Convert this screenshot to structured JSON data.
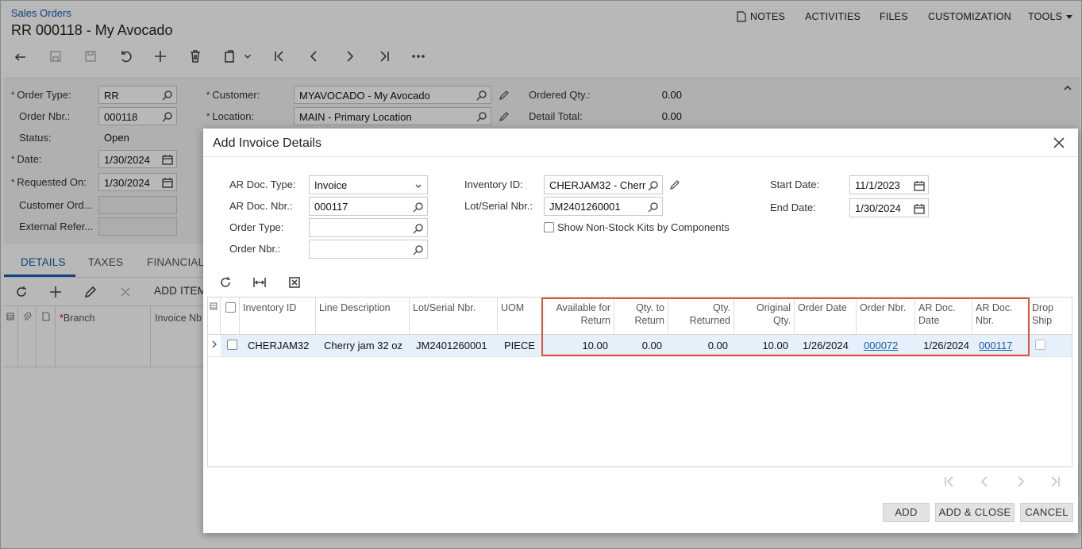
{
  "header": {
    "breadcrumb": "Sales Orders",
    "title": "RR 000118 - My Avocado",
    "nav": [
      "NOTES",
      "ACTIVITIES",
      "FILES",
      "CUSTOMIZATION",
      "TOOLS"
    ]
  },
  "summary": {
    "order_type_label": "Order Type:",
    "order_type": "RR",
    "order_nbr_label": "Order Nbr.:",
    "order_nbr": "000118",
    "status_label": "Status:",
    "status": "Open",
    "date_label": "Date:",
    "date": "1/30/2024",
    "requested_on_label": "Requested On:",
    "requested_on": "1/30/2024",
    "customer_ord_label": "Customer Ord...",
    "external_ref_label": "External Refer...",
    "customer_label": "Customer:",
    "customer": "MYAVOCADO - My Avocado",
    "location_label": "Location:",
    "location": "MAIN - Primary Location",
    "ordered_qty_label": "Ordered Qty.:",
    "ordered_qty": "0.00",
    "detail_total_label": "Detail Total:",
    "detail_total": "0.00"
  },
  "tabs": [
    "DETAILS",
    "TAXES",
    "FINANCIAL"
  ],
  "details_toolbar": {
    "add_item": "ADD ITEM"
  },
  "details_grid": {
    "branch": "Branch",
    "invoice_nbr": "Invoice Nb"
  },
  "dialog": {
    "title": "Add Invoice Details",
    "ar_doc_type_label": "AR Doc. Type:",
    "ar_doc_type": "Invoice",
    "ar_doc_nbr_label": "AR Doc. Nbr.:",
    "ar_doc_nbr": "000117",
    "order_type_label": "Order Type:",
    "order_type": "",
    "order_nbr_label": "Order Nbr.:",
    "order_nbr": "",
    "inventory_id_label": "Inventory ID:",
    "inventory_id": "CHERJAM32 - Cherr",
    "lot_serial_label": "Lot/Serial Nbr.:",
    "lot_serial": "JM2401260001",
    "show_nonstock_label": "Show Non-Stock Kits by Components",
    "start_date_label": "Start Date:",
    "start_date": "11/1/2023",
    "end_date_label": "End Date:",
    "end_date": "1/30/2024",
    "columns": {
      "inventory_id": "Inventory ID",
      "line_desc": "Line Description",
      "lot_serial": "Lot/Serial Nbr.",
      "uom": "UOM",
      "avail": "Available for Return",
      "qty_to_return": "Qty. to Return",
      "qty_returned": "Qty. Returned",
      "orig_qty": "Original Qty.",
      "order_date": "Order Date",
      "order_nbr": "Order Nbr.",
      "ar_doc_date": "AR Doc. Date",
      "ar_doc_nbr": "AR Doc. Nbr.",
      "drop_ship": "Drop Ship"
    },
    "rows": [
      {
        "inventory_id": "CHERJAM32",
        "line_desc": "Cherry jam 32 oz",
        "lot_serial": "JM2401260001",
        "uom": "PIECE",
        "avail": "10.00",
        "qty_to_return": "0.00",
        "qty_returned": "0.00",
        "orig_qty": "10.00",
        "order_date": "1/26/2024",
        "order_nbr": "000072",
        "ar_doc_date": "1/26/2024",
        "ar_doc_nbr": "000117"
      }
    ],
    "buttons": {
      "add": "ADD",
      "add_close": "ADD & CLOSE",
      "cancel": "CANCEL"
    }
  },
  "colors": {
    "accent": "#1a5aad",
    "highlight_border": "#e0533a",
    "selected_row": "#e6f0fa"
  }
}
